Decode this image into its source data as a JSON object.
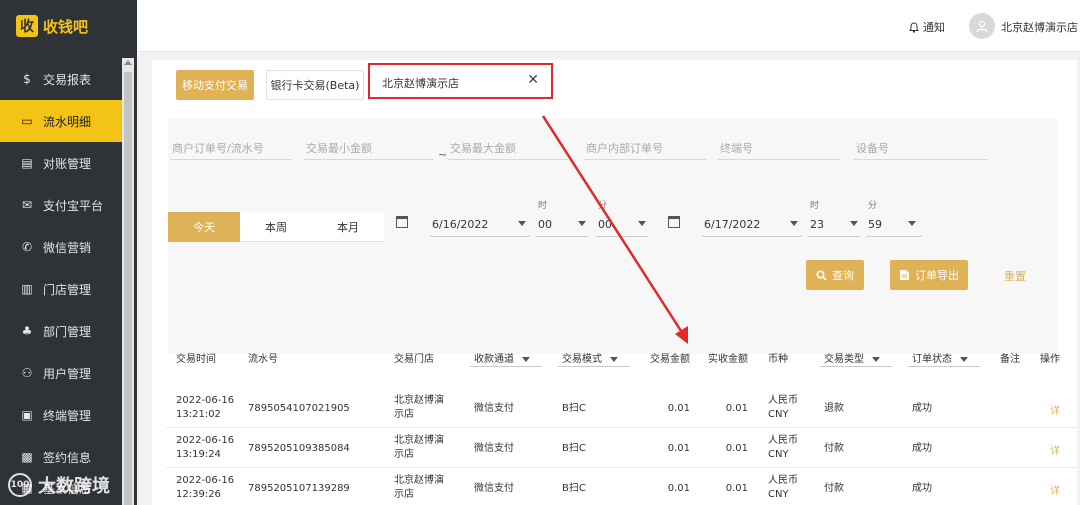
{
  "app": {
    "logo_badge": "收",
    "logo_text": "收钱吧"
  },
  "header": {
    "notify_label": "通知",
    "user_name": "北京赵博演示店"
  },
  "sidebar": {
    "items": [
      {
        "label": "交易报表",
        "icon": "dollar-icon",
        "glyph": "$"
      },
      {
        "label": "流水明细",
        "icon": "card-icon",
        "glyph": "▭"
      },
      {
        "label": "对账管理",
        "icon": "document-icon",
        "glyph": "▤"
      },
      {
        "label": "支付宝平台",
        "icon": "alipay-icon",
        "glyph": "✉"
      },
      {
        "label": "微信营销",
        "icon": "wechat-icon",
        "glyph": "✆"
      },
      {
        "label": "门店管理",
        "icon": "store-icon",
        "glyph": "▥"
      },
      {
        "label": "部门管理",
        "icon": "org-chart-icon",
        "glyph": "♣"
      },
      {
        "label": "用户管理",
        "icon": "users-icon",
        "glyph": "⚇"
      },
      {
        "label": "终端管理",
        "icon": "terminal-icon",
        "glyph": "▣"
      },
      {
        "label": "签约信息",
        "icon": "contract-icon",
        "glyph": "▩"
      },
      {
        "label": "基本信息",
        "icon": "info-icon",
        "glyph": "▦"
      }
    ],
    "active_index": 1
  },
  "tabs": {
    "mobile": "移动支付交易",
    "bank": "银行卡交易(Beta)",
    "store": "北京赵博演示店",
    "close": "✕"
  },
  "filters": {
    "order_no": "商户订单号/流水号",
    "min_amount": "交易最小金额",
    "tilde": "~",
    "max_amount": "交易最大金额",
    "internal_order": "商户内部订单号",
    "terminal_no": "终端号",
    "device_no": "设备号",
    "today": "今天",
    "this_week": "本周",
    "this_month": "本月",
    "start_date": "6/16/2022",
    "start_hour_label": "时",
    "start_hour": "00",
    "start_min_label": "分",
    "start_min": "00",
    "end_date": "6/17/2022",
    "end_hour_label": "时",
    "end_hour": "23",
    "end_min_label": "分",
    "end_min": "59",
    "search": "查询",
    "export": "订单导出",
    "reset": "重置"
  },
  "table": {
    "headers": [
      "交易时间",
      "流水号",
      "交易门店",
      "收款通道",
      "交易模式",
      "交易金额",
      "实收金额",
      "币种",
      "交易类型",
      "订单状态",
      "备注",
      "操作"
    ],
    "rows": [
      {
        "date": "2022-06-16",
        "time": "13:21:02",
        "serial": "7895054107021905",
        "store1": "北京赵博演",
        "store2": "示店",
        "channel": "微信支付",
        "mode": "B扫C",
        "amount": "0.01",
        "received": "0.01",
        "cur1": "人民币",
        "cur2": "CNY",
        "type": "退款",
        "status": "成功",
        "action": "详"
      },
      {
        "date": "2022-06-16",
        "time": "13:19:24",
        "serial": "7895205109385084",
        "store1": "北京赵博演",
        "store2": "示店",
        "channel": "微信支付",
        "mode": "B扫C",
        "amount": "0.01",
        "received": "0.01",
        "cur1": "人民币",
        "cur2": "CNY",
        "type": "付款",
        "status": "成功",
        "action": "详"
      },
      {
        "date": "2022-06-16",
        "time": "12:39:26",
        "serial": "7895205107139289",
        "store1": "北京赵博演",
        "store2": "示店",
        "channel": "微信支付",
        "mode": "B扫C",
        "amount": "0.01",
        "received": "0.01",
        "cur1": "人民币",
        "cur2": "CNY",
        "type": "付款",
        "status": "成功",
        "action": "详"
      }
    ]
  },
  "watermark": {
    "logo": "100",
    "text": "大数跨境"
  },
  "colors": {
    "accent": "#e0b257",
    "sidebar_bg": "#2f3237",
    "active": "#f3c316",
    "highlight_red": "#e02a2a"
  }
}
